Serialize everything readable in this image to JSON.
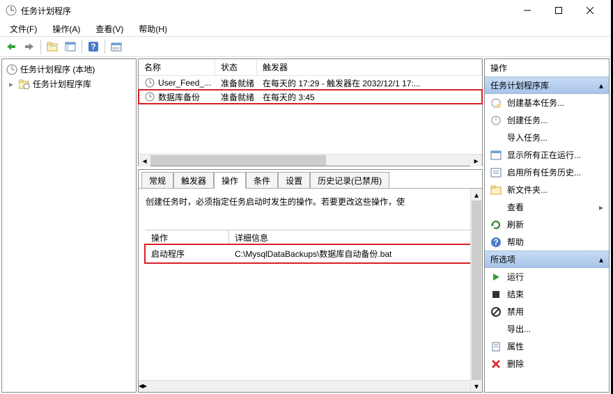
{
  "window": {
    "title": "任务计划程序"
  },
  "menubar": {
    "file": "文件(F)",
    "action": "操作(A)",
    "view": "查看(V)",
    "help": "帮助(H)"
  },
  "tree": {
    "root": "任务计划程序 (本地)",
    "library": "任务计划程序库"
  },
  "task_list": {
    "headers": {
      "name": "名称",
      "status": "状态",
      "trigger": "触发器"
    },
    "rows": [
      {
        "name": "User_Feed_...",
        "status": "准备就绪",
        "trigger": "在每天的 17:29 - 触发器在 2032/12/1 17:..."
      },
      {
        "name": "数据库备份",
        "status": "准备就绪",
        "trigger": "在每天的 3:45"
      }
    ]
  },
  "detail": {
    "tabs": {
      "general": "常规",
      "triggers": "触发器",
      "actions": "操作",
      "conditions": "条件",
      "settings": "设置",
      "history": "历史记录(已禁用)"
    },
    "desc": "创建任务时，必须指定任务启动时发生的操作。若要更改这些操作，使",
    "action_header": {
      "action": "操作",
      "detail": "详细信息"
    },
    "action_row": {
      "type": "启动程序",
      "path": "C:\\MysqlDataBackups\\数据库自动备份.bat"
    }
  },
  "right": {
    "title": "操作",
    "section1": "任务计划程序库",
    "items1": [
      {
        "icon": "create-basic",
        "label": "创建基本任务..."
      },
      {
        "icon": "create",
        "label": "创建任务..."
      },
      {
        "icon": "import",
        "label": "导入任务..."
      },
      {
        "icon": "show-running",
        "label": "显示所有正在运行..."
      },
      {
        "icon": "enable-history",
        "label": "启用所有任务历史..."
      },
      {
        "icon": "new-folder",
        "label": "新文件夹..."
      },
      {
        "icon": "view",
        "label": "查看",
        "submenu": true
      },
      {
        "icon": "refresh",
        "label": "刷新"
      },
      {
        "icon": "help",
        "label": "帮助"
      }
    ],
    "section2": "所选项",
    "items2": [
      {
        "icon": "run",
        "label": "运行"
      },
      {
        "icon": "end",
        "label": "结束"
      },
      {
        "icon": "disable",
        "label": "禁用"
      },
      {
        "icon": "export",
        "label": "导出..."
      },
      {
        "icon": "properties",
        "label": "属性"
      },
      {
        "icon": "delete",
        "label": "删除"
      }
    ]
  }
}
